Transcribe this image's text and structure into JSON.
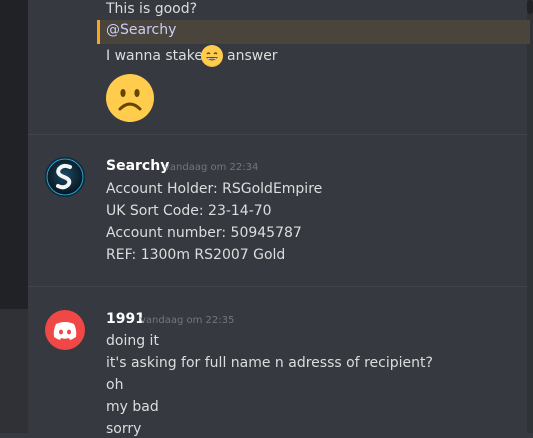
{
  "chat": {
    "previous_group": {
      "lines": [
        "This is good?",
        "I wanna stake",
        "answer"
      ],
      "mention": "@Searchy",
      "inline_emoji": "grinning-face-emoji",
      "big_emoji": "frowning-face-emoji"
    },
    "messages": [
      {
        "username": "Searchy",
        "timestamp": "vandaag om 22:34",
        "avatar": "searchy-avatar-icon",
        "lines": [
          "Account Holder: RSGoldEmpire",
          "UK Sort Code: 23-14-70",
          "Account number: 50945787",
          "REF: 1300m RS2007 Gold"
        ]
      },
      {
        "username": "1991",
        "timestamp": "vandaag om 22:35",
        "avatar": "discord-avatar-icon",
        "lines": [
          "doing it",
          "it's asking for full name n adresss of recipient?",
          "oh",
          "my bad",
          "sorry"
        ]
      }
    ]
  },
  "colors": {
    "background": "#36393f",
    "mention_highlight": "#faa61a",
    "discord_red": "#f04747"
  }
}
